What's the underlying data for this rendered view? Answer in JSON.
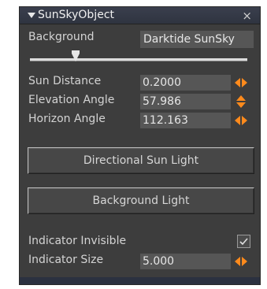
{
  "panel": {
    "title": "SunSkyObject",
    "close_glyph": "×"
  },
  "background": {
    "label": "Background",
    "value": "Darktide SunSky",
    "slider_level": 0.22
  },
  "params": [
    {
      "label": "Sun Distance",
      "value": "0.2000",
      "spinner": "horizontal-arrows-icon"
    },
    {
      "label": "Elevation Angle",
      "value": "57.986",
      "spinner": "vertical-arrows-icon"
    },
    {
      "label": "Horizon Angle",
      "value": "112.163",
      "spinner": "horizontal-arrows-icon"
    }
  ],
  "buttons": {
    "directional": "Directional Sun Light",
    "background_light": "Background Light"
  },
  "indicator": {
    "invisible_label": "Indicator Invisible",
    "invisible_checked": true,
    "size_label": "Indicator Size",
    "size_value": "5.000"
  },
  "colors": {
    "panel_bg": "#3d3d3d",
    "field_bg": "#565656",
    "spinner_accent": "#ff8a1c",
    "titlebar": "#323846"
  }
}
